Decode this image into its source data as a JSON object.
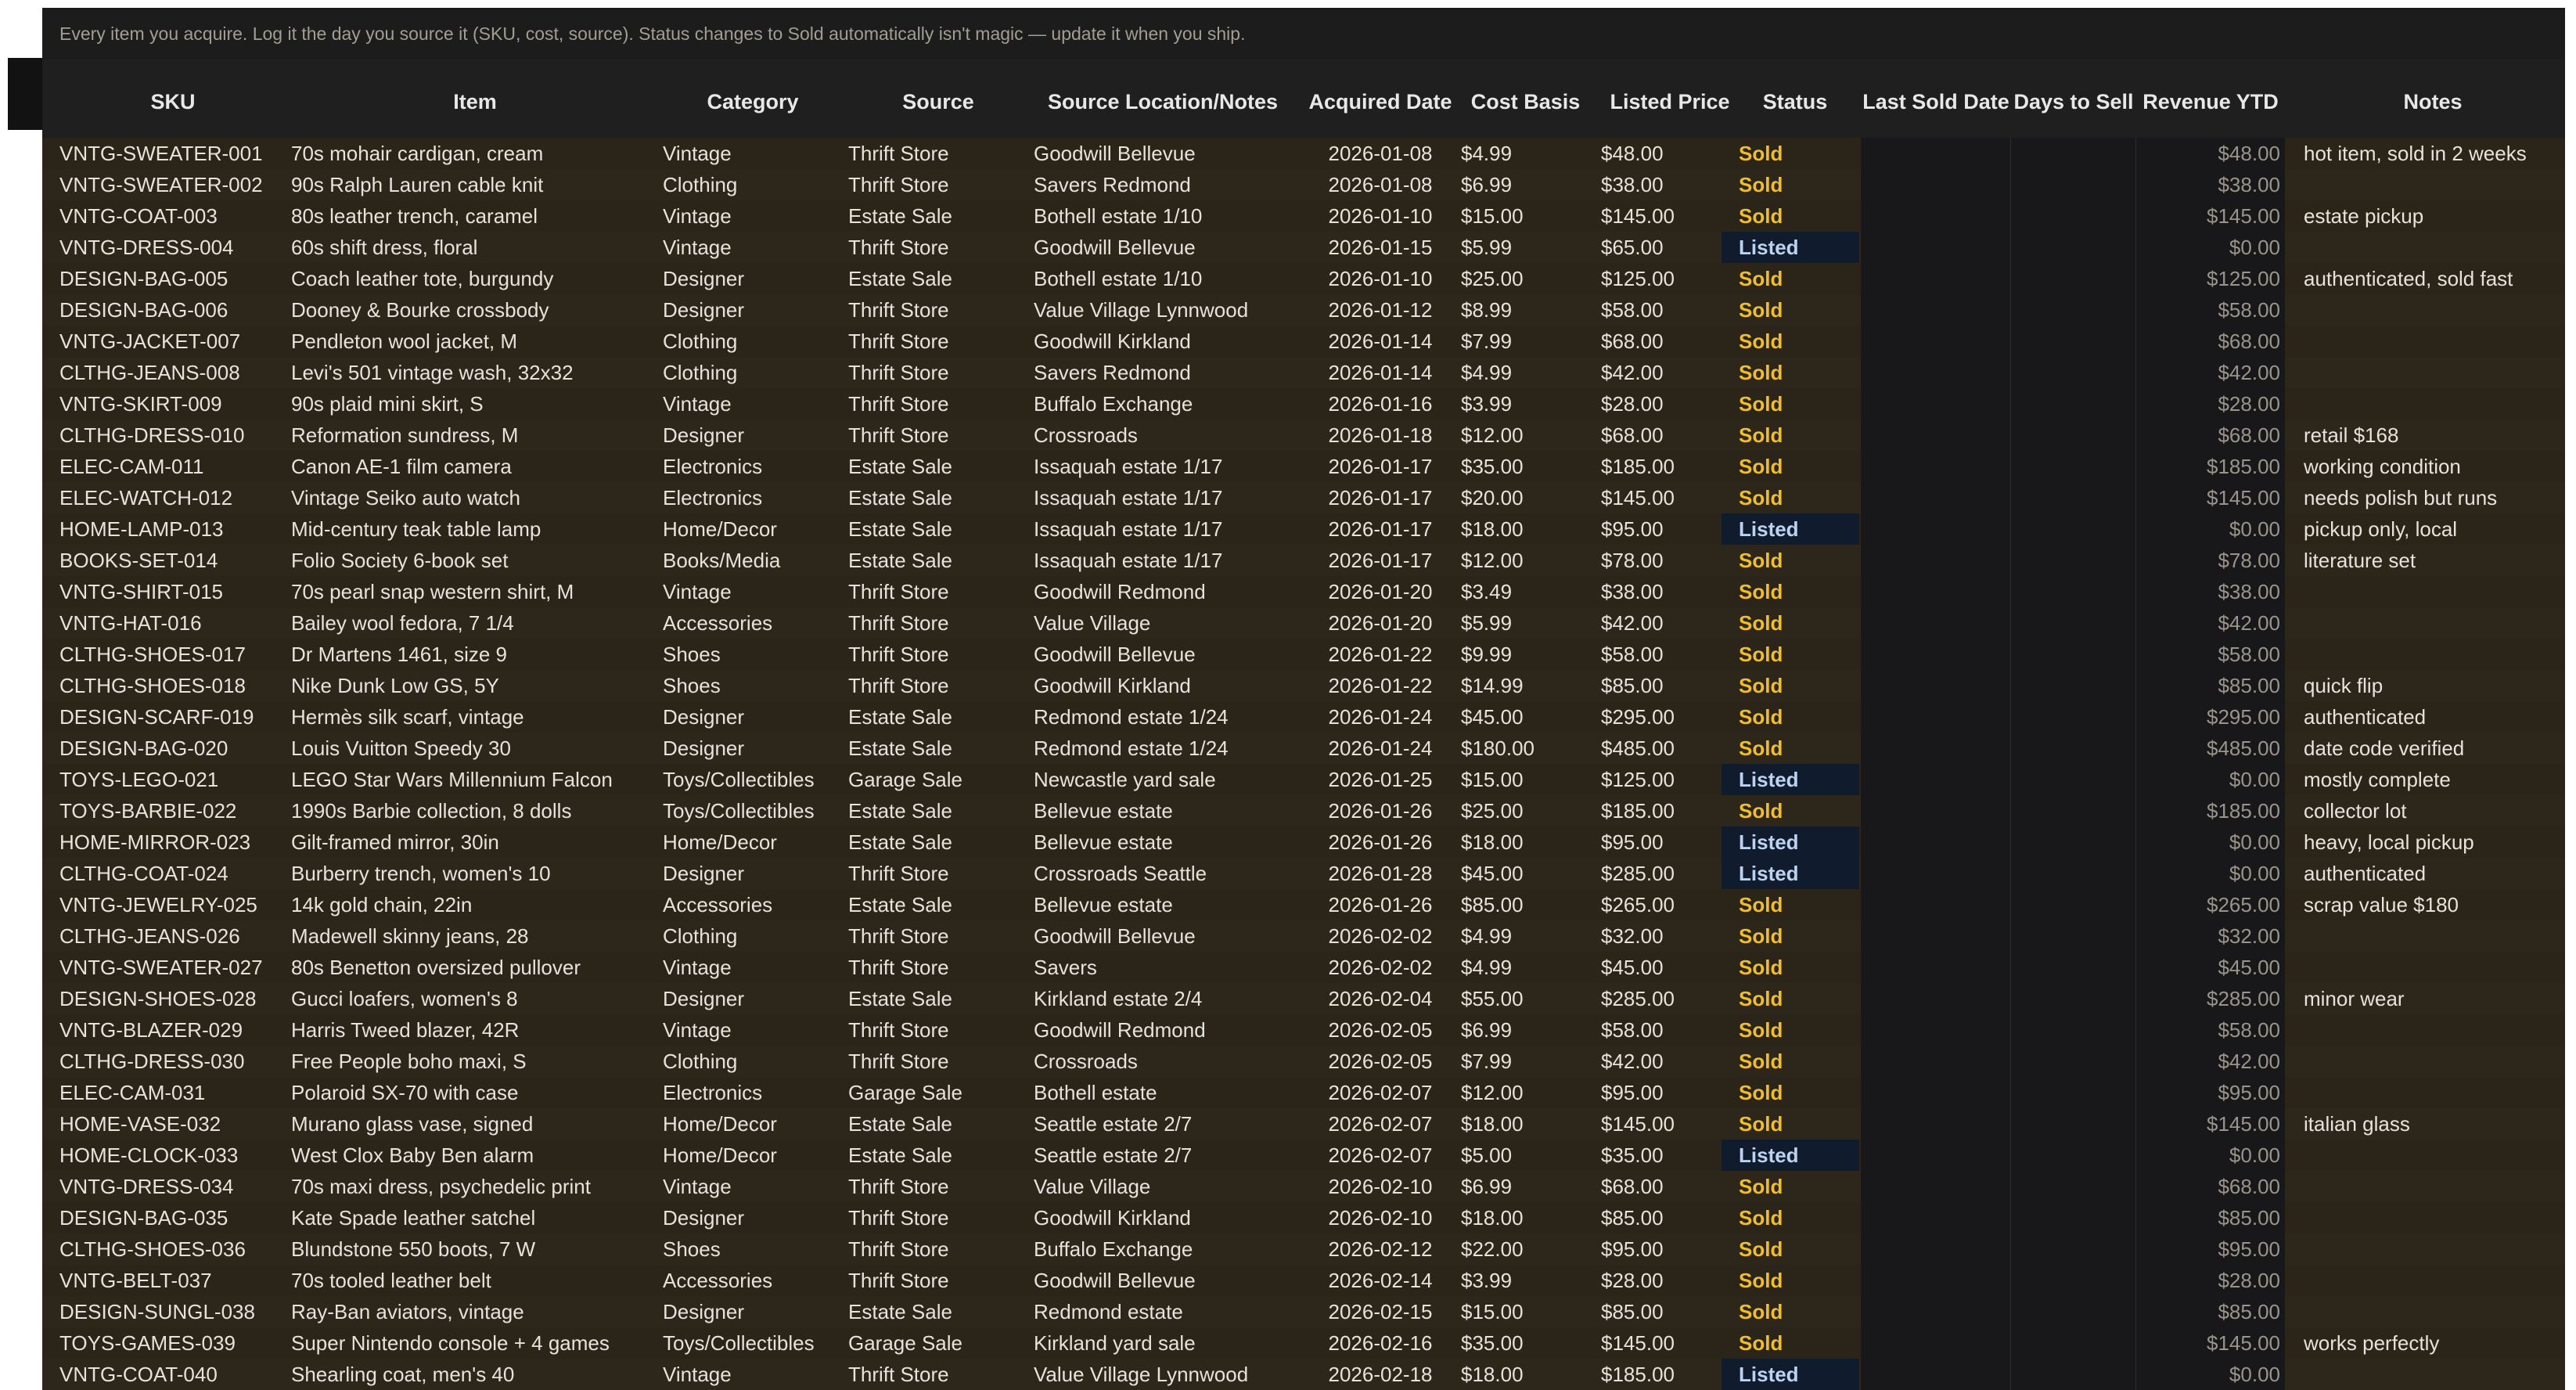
{
  "banner": "Every item you acquire. Log it the day you source it (SKU, cost, source). Status changes to Sold automatically isn't magic — update it when you ship.",
  "columns": {
    "sku": "SKU",
    "item": "Item",
    "category": "Category",
    "source": "Source",
    "location": "Source Location/Notes",
    "acquired": "Acquired Date",
    "cost": "Cost Basis",
    "listed": "Listed Price",
    "status": "Status",
    "last_sold": "Last Sold Date",
    "days_to_sell": "Days to Sell",
    "revenue": "Revenue YTD",
    "notes": "Notes"
  },
  "colors": {
    "sold": "#efbd2e",
    "listed": "#bcd2ef",
    "listed_bg": "#101c2e"
  },
  "rows": [
    {
      "sku": "VNTG-SWEATER-001",
      "item": "70s mohair cardigan, cream",
      "category": "Vintage",
      "source": "Thrift Store",
      "location": "Goodwill Bellevue",
      "acquired": "2026-01-08",
      "cost": "$4.99",
      "listed": "$48.00",
      "status": "Sold",
      "revenue": "$48.00",
      "notes": "hot item, sold in 2 weeks"
    },
    {
      "sku": "VNTG-SWEATER-002",
      "item": "90s Ralph Lauren cable knit",
      "category": "Clothing",
      "source": "Thrift Store",
      "location": "Savers Redmond",
      "acquired": "2026-01-08",
      "cost": "$6.99",
      "listed": "$38.00",
      "status": "Sold",
      "revenue": "$38.00",
      "notes": ""
    },
    {
      "sku": "VNTG-COAT-003",
      "item": "80s leather trench, caramel",
      "category": "Vintage",
      "source": "Estate Sale",
      "location": "Bothell estate 1/10",
      "acquired": "2026-01-10",
      "cost": "$15.00",
      "listed": "$145.00",
      "status": "Sold",
      "revenue": "$145.00",
      "notes": "estate pickup"
    },
    {
      "sku": "VNTG-DRESS-004",
      "item": "60s shift dress, floral",
      "category": "Vintage",
      "source": "Thrift Store",
      "location": "Goodwill Bellevue",
      "acquired": "2026-01-15",
      "cost": "$5.99",
      "listed": "$65.00",
      "status": "Listed",
      "revenue": "$0.00",
      "notes": ""
    },
    {
      "sku": "DESIGN-BAG-005",
      "item": "Coach leather tote, burgundy",
      "category": "Designer",
      "source": "Estate Sale",
      "location": "Bothell estate 1/10",
      "acquired": "2026-01-10",
      "cost": "$25.00",
      "listed": "$125.00",
      "status": "Sold",
      "revenue": "$125.00",
      "notes": "authenticated, sold fast"
    },
    {
      "sku": "DESIGN-BAG-006",
      "item": "Dooney & Bourke crossbody",
      "category": "Designer",
      "source": "Thrift Store",
      "location": "Value Village Lynnwood",
      "acquired": "2026-01-12",
      "cost": "$8.99",
      "listed": "$58.00",
      "status": "Sold",
      "revenue": "$58.00",
      "notes": ""
    },
    {
      "sku": "VNTG-JACKET-007",
      "item": "Pendleton wool jacket, M",
      "category": "Clothing",
      "source": "Thrift Store",
      "location": "Goodwill Kirkland",
      "acquired": "2026-01-14",
      "cost": "$7.99",
      "listed": "$68.00",
      "status": "Sold",
      "revenue": "$68.00",
      "notes": ""
    },
    {
      "sku": "CLTHG-JEANS-008",
      "item": "Levi's 501 vintage wash, 32x32",
      "category": "Clothing",
      "source": "Thrift Store",
      "location": "Savers Redmond",
      "acquired": "2026-01-14",
      "cost": "$4.99",
      "listed": "$42.00",
      "status": "Sold",
      "revenue": "$42.00",
      "notes": ""
    },
    {
      "sku": "VNTG-SKIRT-009",
      "item": "90s plaid mini skirt, S",
      "category": "Vintage",
      "source": "Thrift Store",
      "location": "Buffalo Exchange",
      "acquired": "2026-01-16",
      "cost": "$3.99",
      "listed": "$28.00",
      "status": "Sold",
      "revenue": "$28.00",
      "notes": ""
    },
    {
      "sku": "CLTHG-DRESS-010",
      "item": "Reformation sundress, M",
      "category": "Designer",
      "source": "Thrift Store",
      "location": "Crossroads",
      "acquired": "2026-01-18",
      "cost": "$12.00",
      "listed": "$68.00",
      "status": "Sold",
      "revenue": "$68.00",
      "notes": "retail $168"
    },
    {
      "sku": "ELEC-CAM-011",
      "item": "Canon AE-1 film camera",
      "category": "Electronics",
      "source": "Estate Sale",
      "location": "Issaquah estate 1/17",
      "acquired": "2026-01-17",
      "cost": "$35.00",
      "listed": "$185.00",
      "status": "Sold",
      "revenue": "$185.00",
      "notes": "working condition"
    },
    {
      "sku": "ELEC-WATCH-012",
      "item": "Vintage Seiko auto watch",
      "category": "Electronics",
      "source": "Estate Sale",
      "location": "Issaquah estate 1/17",
      "acquired": "2026-01-17",
      "cost": "$20.00",
      "listed": "$145.00",
      "status": "Sold",
      "revenue": "$145.00",
      "notes": "needs polish but runs"
    },
    {
      "sku": "HOME-LAMP-013",
      "item": "Mid-century teak table lamp",
      "category": "Home/Decor",
      "source": "Estate Sale",
      "location": "Issaquah estate 1/17",
      "acquired": "2026-01-17",
      "cost": "$18.00",
      "listed": "$95.00",
      "status": "Listed",
      "revenue": "$0.00",
      "notes": "pickup only, local"
    },
    {
      "sku": "BOOKS-SET-014",
      "item": "Folio Society 6-book set",
      "category": "Books/Media",
      "source": "Estate Sale",
      "location": "Issaquah estate 1/17",
      "acquired": "2026-01-17",
      "cost": "$12.00",
      "listed": "$78.00",
      "status": "Sold",
      "revenue": "$78.00",
      "notes": "literature set"
    },
    {
      "sku": "VNTG-SHIRT-015",
      "item": "70s pearl snap western shirt, M",
      "category": "Vintage",
      "source": "Thrift Store",
      "location": "Goodwill Redmond",
      "acquired": "2026-01-20",
      "cost": "$3.49",
      "listed": "$38.00",
      "status": "Sold",
      "revenue": "$38.00",
      "notes": ""
    },
    {
      "sku": "VNTG-HAT-016",
      "item": "Bailey wool fedora, 7 1/4",
      "category": "Accessories",
      "source": "Thrift Store",
      "location": "Value Village",
      "acquired": "2026-01-20",
      "cost": "$5.99",
      "listed": "$42.00",
      "status": "Sold",
      "revenue": "$42.00",
      "notes": ""
    },
    {
      "sku": "CLTHG-SHOES-017",
      "item": "Dr Martens 1461, size 9",
      "category": "Shoes",
      "source": "Thrift Store",
      "location": "Goodwill Bellevue",
      "acquired": "2026-01-22",
      "cost": "$9.99",
      "listed": "$58.00",
      "status": "Sold",
      "revenue": "$58.00",
      "notes": ""
    },
    {
      "sku": "CLTHG-SHOES-018",
      "item": "Nike Dunk Low GS, 5Y",
      "category": "Shoes",
      "source": "Thrift Store",
      "location": "Goodwill Kirkland",
      "acquired": "2026-01-22",
      "cost": "$14.99",
      "listed": "$85.00",
      "status": "Sold",
      "revenue": "$85.00",
      "notes": "quick flip"
    },
    {
      "sku": "DESIGN-SCARF-019",
      "item": "Hermès silk scarf, vintage",
      "category": "Designer",
      "source": "Estate Sale",
      "location": "Redmond estate 1/24",
      "acquired": "2026-01-24",
      "cost": "$45.00",
      "listed": "$295.00",
      "status": "Sold",
      "revenue": "$295.00",
      "notes": "authenticated"
    },
    {
      "sku": "DESIGN-BAG-020",
      "item": "Louis Vuitton Speedy 30",
      "category": "Designer",
      "source": "Estate Sale",
      "location": "Redmond estate 1/24",
      "acquired": "2026-01-24",
      "cost": "$180.00",
      "listed": "$485.00",
      "status": "Sold",
      "revenue": "$485.00",
      "notes": "date code verified"
    },
    {
      "sku": "TOYS-LEGO-021",
      "item": "LEGO Star Wars Millennium Falcon",
      "category": "Toys/Collectibles",
      "source": "Garage Sale",
      "location": "Newcastle yard sale",
      "acquired": "2026-01-25",
      "cost": "$15.00",
      "listed": "$125.00",
      "status": "Listed",
      "revenue": "$0.00",
      "notes": "mostly complete"
    },
    {
      "sku": "TOYS-BARBIE-022",
      "item": "1990s Barbie collection, 8 dolls",
      "category": "Toys/Collectibles",
      "source": "Estate Sale",
      "location": "Bellevue estate",
      "acquired": "2026-01-26",
      "cost": "$25.00",
      "listed": "$185.00",
      "status": "Sold",
      "revenue": "$185.00",
      "notes": "collector lot"
    },
    {
      "sku": "HOME-MIRROR-023",
      "item": "Gilt-framed mirror, 30in",
      "category": "Home/Decor",
      "source": "Estate Sale",
      "location": "Bellevue estate",
      "acquired": "2026-01-26",
      "cost": "$18.00",
      "listed": "$95.00",
      "status": "Listed",
      "revenue": "$0.00",
      "notes": "heavy, local pickup"
    },
    {
      "sku": "CLTHG-COAT-024",
      "item": "Burberry trench, women's 10",
      "category": "Designer",
      "source": "Thrift Store",
      "location": "Crossroads Seattle",
      "acquired": "2026-01-28",
      "cost": "$45.00",
      "listed": "$285.00",
      "status": "Listed",
      "revenue": "$0.00",
      "notes": "authenticated"
    },
    {
      "sku": "VNTG-JEWELRY-025",
      "item": "14k gold chain, 22in",
      "category": "Accessories",
      "source": "Estate Sale",
      "location": "Bellevue estate",
      "acquired": "2026-01-26",
      "cost": "$85.00",
      "listed": "$265.00",
      "status": "Sold",
      "revenue": "$265.00",
      "notes": "scrap value $180"
    },
    {
      "sku": "CLTHG-JEANS-026",
      "item": "Madewell skinny jeans, 28",
      "category": "Clothing",
      "source": "Thrift Store",
      "location": "Goodwill Bellevue",
      "acquired": "2026-02-02",
      "cost": "$4.99",
      "listed": "$32.00",
      "status": "Sold",
      "revenue": "$32.00",
      "notes": ""
    },
    {
      "sku": "VNTG-SWEATER-027",
      "item": "80s Benetton oversized pullover",
      "category": "Vintage",
      "source": "Thrift Store",
      "location": "Savers",
      "acquired": "2026-02-02",
      "cost": "$4.99",
      "listed": "$45.00",
      "status": "Sold",
      "revenue": "$45.00",
      "notes": ""
    },
    {
      "sku": "DESIGN-SHOES-028",
      "item": "Gucci loafers, women's 8",
      "category": "Designer",
      "source": "Estate Sale",
      "location": "Kirkland estate 2/4",
      "acquired": "2026-02-04",
      "cost": "$55.00",
      "listed": "$285.00",
      "status": "Sold",
      "revenue": "$285.00",
      "notes": "minor wear"
    },
    {
      "sku": "VNTG-BLAZER-029",
      "item": "Harris Tweed blazer, 42R",
      "category": "Vintage",
      "source": "Thrift Store",
      "location": "Goodwill Redmond",
      "acquired": "2026-02-05",
      "cost": "$6.99",
      "listed": "$58.00",
      "status": "Sold",
      "revenue": "$58.00",
      "notes": ""
    },
    {
      "sku": "CLTHG-DRESS-030",
      "item": "Free People boho maxi, S",
      "category": "Clothing",
      "source": "Thrift Store",
      "location": "Crossroads",
      "acquired": "2026-02-05",
      "cost": "$7.99",
      "listed": "$42.00",
      "status": "Sold",
      "revenue": "$42.00",
      "notes": ""
    },
    {
      "sku": "ELEC-CAM-031",
      "item": "Polaroid SX-70 with case",
      "category": "Electronics",
      "source": "Garage Sale",
      "location": "Bothell estate",
      "acquired": "2026-02-07",
      "cost": "$12.00",
      "listed": "$95.00",
      "status": "Sold",
      "revenue": "$95.00",
      "notes": ""
    },
    {
      "sku": "HOME-VASE-032",
      "item": "Murano glass vase, signed",
      "category": "Home/Decor",
      "source": "Estate Sale",
      "location": "Seattle estate 2/7",
      "acquired": "2026-02-07",
      "cost": "$18.00",
      "listed": "$145.00",
      "status": "Sold",
      "revenue": "$145.00",
      "notes": "italian glass"
    },
    {
      "sku": "HOME-CLOCK-033",
      "item": "West Clox Baby Ben alarm",
      "category": "Home/Decor",
      "source": "Estate Sale",
      "location": "Seattle estate 2/7",
      "acquired": "2026-02-07",
      "cost": "$5.00",
      "listed": "$35.00",
      "status": "Listed",
      "revenue": "$0.00",
      "notes": ""
    },
    {
      "sku": "VNTG-DRESS-034",
      "item": "70s maxi dress, psychedelic print",
      "category": "Vintage",
      "source": "Thrift Store",
      "location": "Value Village",
      "acquired": "2026-02-10",
      "cost": "$6.99",
      "listed": "$68.00",
      "status": "Sold",
      "revenue": "$68.00",
      "notes": ""
    },
    {
      "sku": "DESIGN-BAG-035",
      "item": "Kate Spade leather satchel",
      "category": "Designer",
      "source": "Thrift Store",
      "location": "Goodwill Kirkland",
      "acquired": "2026-02-10",
      "cost": "$18.00",
      "listed": "$85.00",
      "status": "Sold",
      "revenue": "$85.00",
      "notes": ""
    },
    {
      "sku": "CLTHG-SHOES-036",
      "item": "Blundstone 550 boots, 7 W",
      "category": "Shoes",
      "source": "Thrift Store",
      "location": "Buffalo Exchange",
      "acquired": "2026-02-12",
      "cost": "$22.00",
      "listed": "$95.00",
      "status": "Sold",
      "revenue": "$95.00",
      "notes": ""
    },
    {
      "sku": "VNTG-BELT-037",
      "item": "70s tooled leather belt",
      "category": "Accessories",
      "source": "Thrift Store",
      "location": "Goodwill Bellevue",
      "acquired": "2026-02-14",
      "cost": "$3.99",
      "listed": "$28.00",
      "status": "Sold",
      "revenue": "$28.00",
      "notes": ""
    },
    {
      "sku": "DESIGN-SUNGL-038",
      "item": "Ray-Ban aviators, vintage",
      "category": "Designer",
      "source": "Estate Sale",
      "location": "Redmond estate",
      "acquired": "2026-02-15",
      "cost": "$15.00",
      "listed": "$85.00",
      "status": "Sold",
      "revenue": "$85.00",
      "notes": ""
    },
    {
      "sku": "TOYS-GAMES-039",
      "item": "Super Nintendo console + 4 games",
      "category": "Toys/Collectibles",
      "source": "Garage Sale",
      "location": "Kirkland yard sale",
      "acquired": "2026-02-16",
      "cost": "$35.00",
      "listed": "$145.00",
      "status": "Sold",
      "revenue": "$145.00",
      "notes": "works perfectly"
    },
    {
      "sku": "VNTG-COAT-040",
      "item": "Shearling coat, men's 40",
      "category": "Vintage",
      "source": "Thrift Store",
      "location": "Value Village Lynnwood",
      "acquired": "2026-02-18",
      "cost": "$18.00",
      "listed": "$185.00",
      "status": "Listed",
      "revenue": "$0.00",
      "notes": ""
    }
  ]
}
